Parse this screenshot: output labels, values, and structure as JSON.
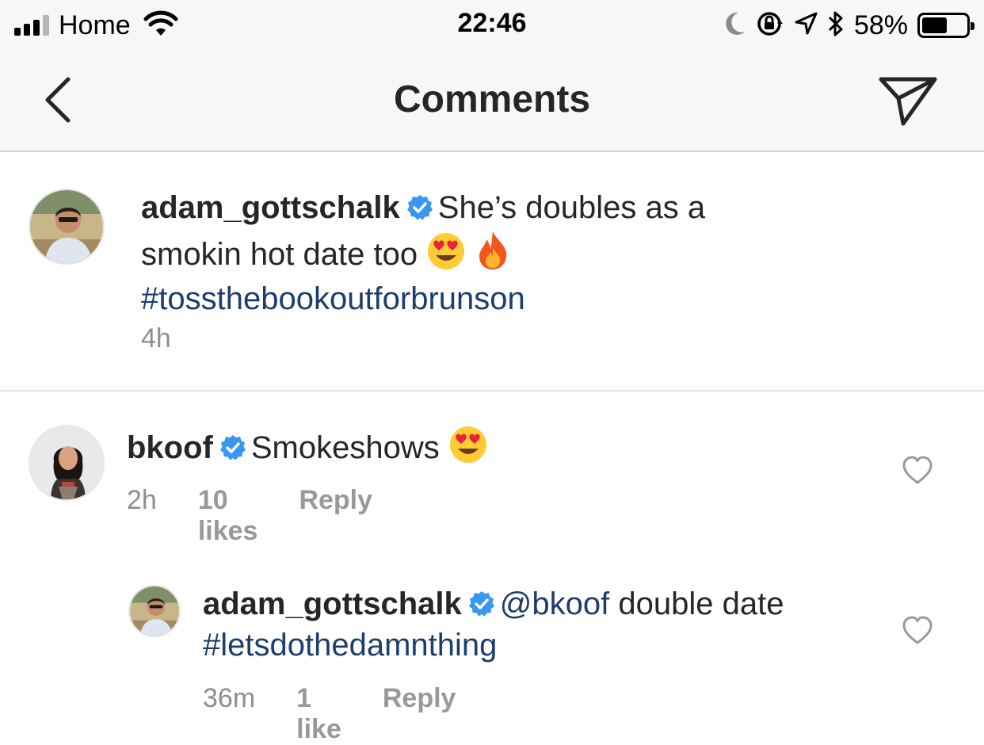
{
  "status_bar": {
    "carrier": "Home",
    "time": "22:46",
    "battery_percent": "58%",
    "battery_level": 0.58
  },
  "nav": {
    "title": "Comments"
  },
  "caption": {
    "username": "adam_gottschalk",
    "text_line1": "She’s doubles as a",
    "text_line2": "smokin hot date too",
    "hashtag": "#tossthebookoutforbrunson",
    "time": "4h"
  },
  "comments": [
    {
      "username": "bkoof",
      "text": "Smokeshows",
      "time": "2h",
      "likes": "10 likes",
      "reply_label": "Reply"
    }
  ],
  "replies": [
    {
      "username": "adam_gottschalk",
      "mention": "@bkoof",
      "text": "double date",
      "hashtag": "#letsdothedamnthing",
      "time": "36m",
      "likes": "1 like",
      "reply_label": "Reply"
    }
  ],
  "colors": {
    "hashtag": "#1c3d6e",
    "verified": "#3897f0",
    "meta": "#8e8e8e"
  }
}
